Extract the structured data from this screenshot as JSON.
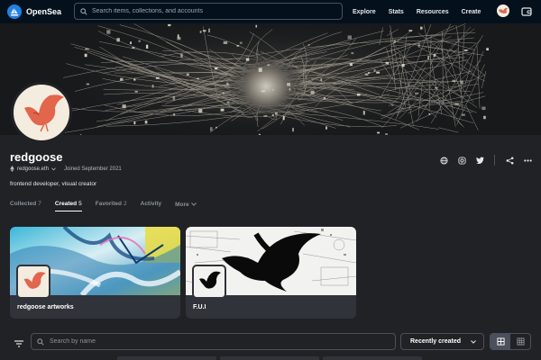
{
  "nav": {
    "brand": "OpenSea",
    "search_placeholder": "Search items, collections, and accounts",
    "links": [
      "Explore",
      "Stats",
      "Resources",
      "Create"
    ]
  },
  "profile": {
    "username": "redgoose",
    "address": "redgoose.eth",
    "joined": "Joined September 2021",
    "bio": "frontend developer, visual creator"
  },
  "tabs": [
    {
      "label": "Collected",
      "count": "7"
    },
    {
      "label": "Created",
      "count": "5"
    },
    {
      "label": "Favorited",
      "count": "2"
    },
    {
      "label": "Activity",
      "count": ""
    },
    {
      "label": "More",
      "count": ""
    }
  ],
  "collections": [
    {
      "title": "redgoose artworks"
    },
    {
      "title": "F.U.I"
    }
  ],
  "filter": {
    "search_placeholder": "Search by name",
    "sort_label": "Recently created"
  },
  "colors": {
    "brand": "#2081e2",
    "nav_bg": "#04111d",
    "page_bg": "#202225",
    "card_bg": "#303339",
    "goose": "#e2664c"
  },
  "icons": {
    "action_buttons": [
      "globe-icon",
      "instagram-icon",
      "twitter-icon",
      "share-icon",
      "more-icon"
    ]
  }
}
